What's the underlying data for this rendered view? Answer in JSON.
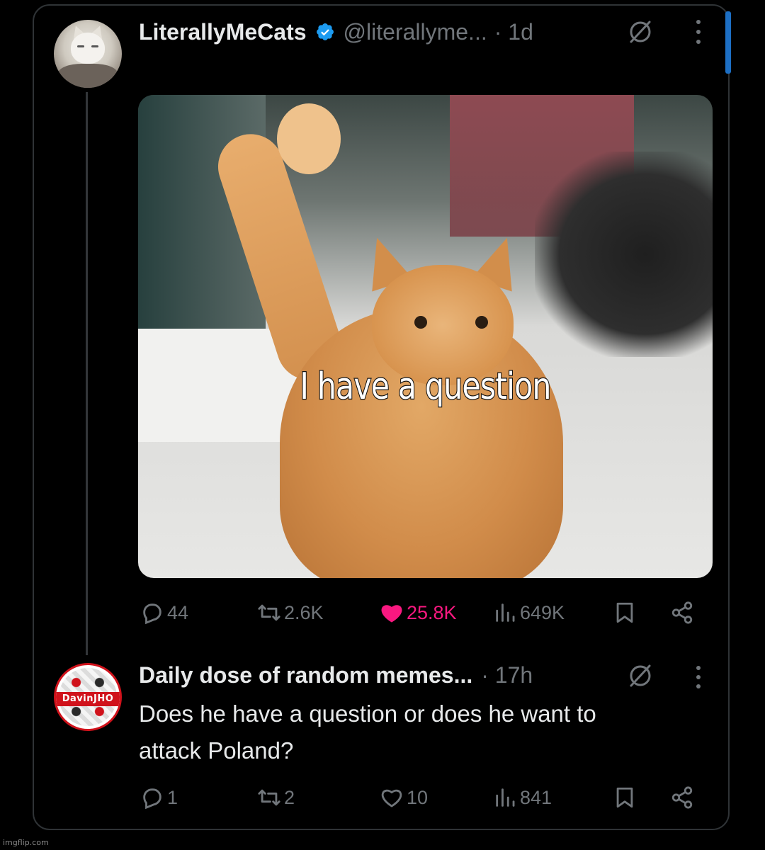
{
  "post": {
    "author_name": "LiterallyMeCats",
    "handle": "@literallyme...",
    "time": "· 1d",
    "image_caption": "I have a question",
    "stats": {
      "replies": "44",
      "reposts": "2.6K",
      "likes": "25.8K",
      "views": "649K"
    }
  },
  "reply": {
    "author_name": "Daily dose of random memes...",
    "time": "· 17h",
    "avatar_text": "DavinJHO",
    "text_line1": "Does he have a question or does he want to",
    "text_line2": "attack Poland?",
    "stats": {
      "replies": "1",
      "reposts": "2",
      "likes": "10",
      "views": "841"
    }
  },
  "watermark": "imgflip.com",
  "colors": {
    "background": "#000000",
    "text_primary": "#e7e9ea",
    "text_secondary": "#71767b",
    "like_active": "#f91880",
    "verified_blue": "#1d9bf0",
    "border": "#2f3336"
  },
  "icons": [
    "verified-icon",
    "grok-icon",
    "more-icon",
    "reply-icon",
    "repost-icon",
    "like-icon",
    "views-icon",
    "bookmark-icon",
    "share-icon"
  ]
}
